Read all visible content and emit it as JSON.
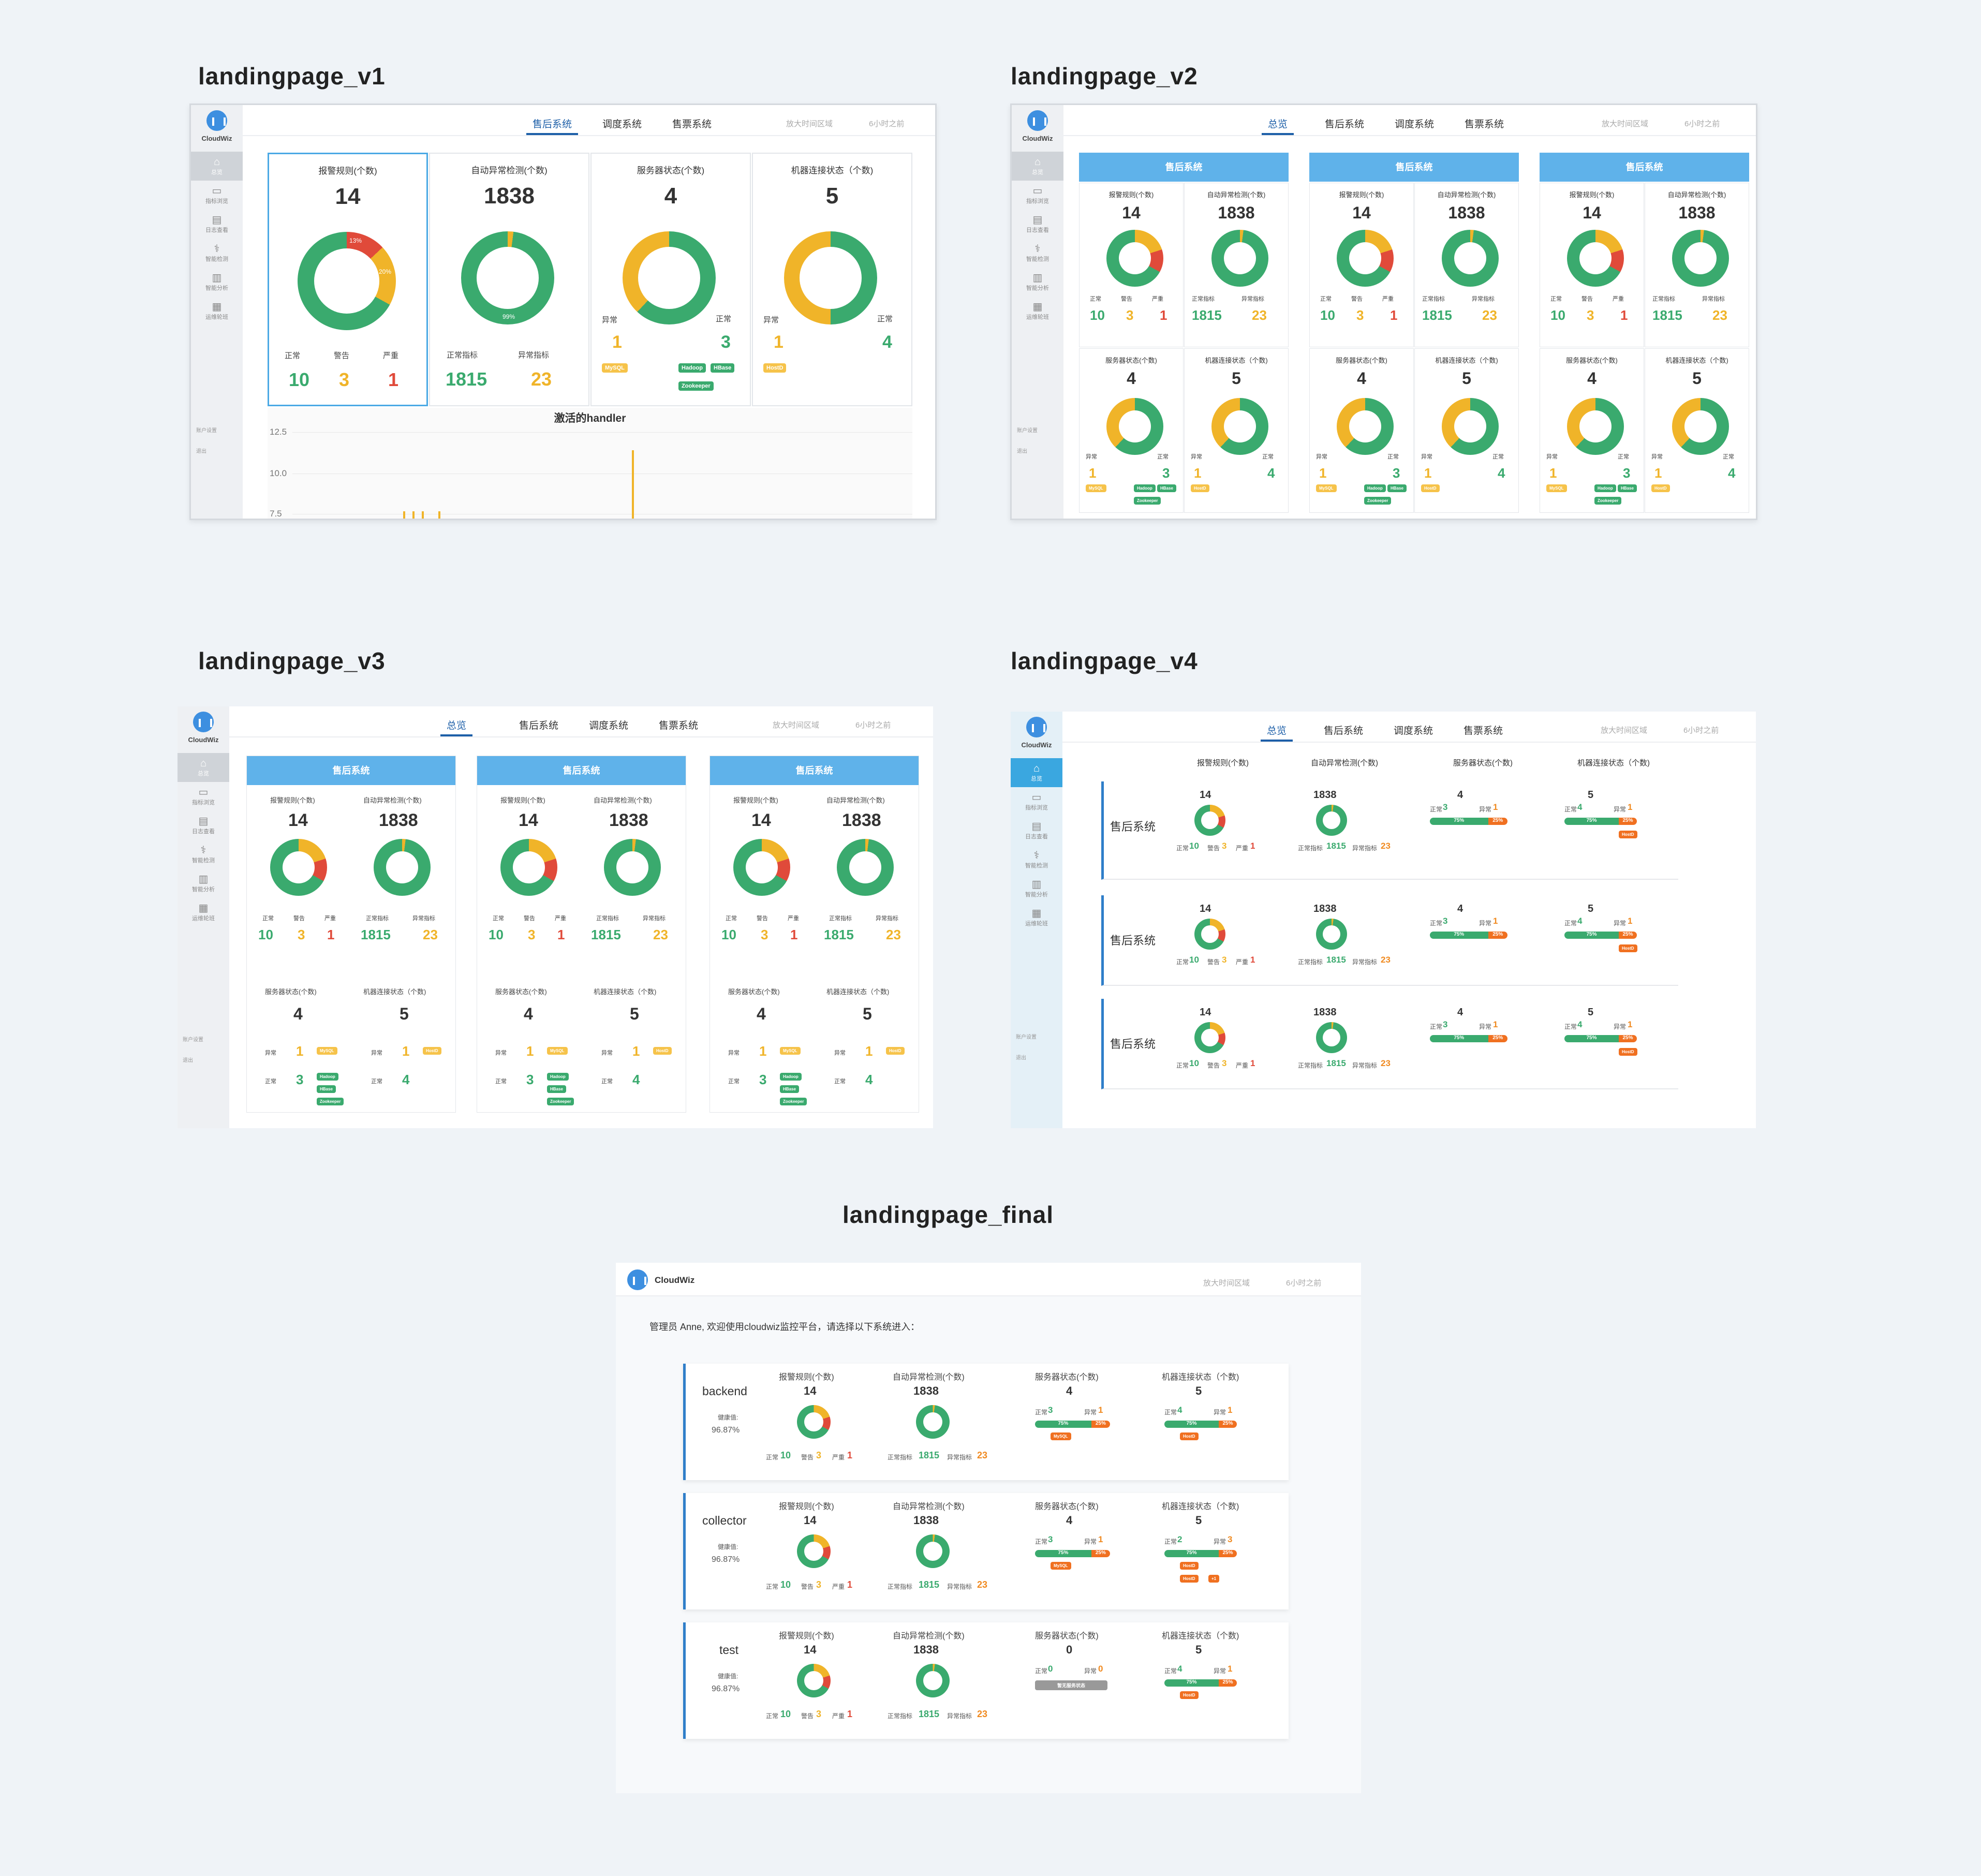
{
  "versions": {
    "v1": "landingpage_v1",
    "v2": "landingpage_v2",
    "v3": "landingpage_v3",
    "v4": "landingpage_v4",
    "final": "landingpage_final"
  },
  "app": {
    "logo": "CloudWiz"
  },
  "sidebar": {
    "items": [
      {
        "label": "总览",
        "icon": "home-icon"
      },
      {
        "label": "指标浏览",
        "icon": "monitor-icon"
      },
      {
        "label": "日志查看",
        "icon": "document-icon"
      },
      {
        "label": "智能检测",
        "icon": "stethoscope-icon"
      },
      {
        "label": "智能分析",
        "icon": "bar-chart-icon"
      },
      {
        "label": "运维轮班",
        "icon": "schedule-icon"
      }
    ],
    "account": "账户设置",
    "logout": "退出"
  },
  "nav": {
    "tabs_v1": [
      "售后系统",
      "调度系统",
      "售票系统"
    ],
    "tabs": [
      "总览",
      "售后系统",
      "调度系统",
      "售票系统"
    ],
    "zoom": "放大时间区域",
    "time": "6小时之前"
  },
  "metrics": {
    "alarm_title": "报警规则(个数)",
    "alarm_total": "14",
    "anomaly_title": "自动异常检测(个数)",
    "anomaly_total": "1838",
    "server_title": "服务器状态(个数)",
    "server_total": "4",
    "machine_title": "机器连接状态（个数)",
    "machine_total": "5",
    "normal": "正常",
    "warning": "警告",
    "severe": "严重",
    "normal_count": "10",
    "warning_count": "3",
    "severe_count": "1",
    "normal_metric": "正常指标",
    "abnormal_metric": "异常指标",
    "normal_metric_count": "1815",
    "abnormal_metric_count": "23",
    "abnormal": "异常",
    "server_abnormal": "1",
    "server_normal": "3",
    "machine_abnormal": "1",
    "machine_normal": "4",
    "pct_67": "67%",
    "pct_13": "13%",
    "pct_20": "20%",
    "pct_99": "99%",
    "pct_75": "75%",
    "pct_25": "25%",
    "tags_server_abnormal": [
      "MySQL"
    ],
    "tags_server_normal": [
      "Hadoop",
      "HBase",
      "Zookeeper"
    ],
    "tags_machine_abnormal": [
      "HostD"
    ]
  },
  "v1_chart": {
    "title": "激活的handler",
    "yticks": [
      "12.5",
      "10.0",
      "7.5"
    ]
  },
  "system_name": "售后系统",
  "final": {
    "welcome": "管理员 Anne, 欢迎使用cloudwiz监控平台，请选择以下系统进入：",
    "health_label": "健康值:",
    "no_server": "暂无服务状态",
    "systems": [
      {
        "name": "backend",
        "health": "96.87%",
        "server_total": "4",
        "server_normal": "3",
        "server_abnormal": "1",
        "machine_total": "5",
        "machine_normal": "4",
        "machine_abnormal": "1"
      },
      {
        "name": "collector",
        "health": "96.87%",
        "server_total": "4",
        "server_normal": "3",
        "server_abnormal": "1",
        "machine_total": "5",
        "machine_normal": "2",
        "machine_abnormal": "3"
      },
      {
        "name": "test",
        "health": "96.87%",
        "server_total": "0",
        "server_normal": "0",
        "server_abnormal": "0",
        "machine_total": "5",
        "machine_normal": "4",
        "machine_abnormal": "1"
      }
    ],
    "extra_tag": "+1"
  },
  "colors": {
    "green": "#3aaa6e",
    "yellow": "#f0b429",
    "red": "#e04a3a",
    "orange": "#f07020",
    "blue": "#5fb2ea"
  }
}
